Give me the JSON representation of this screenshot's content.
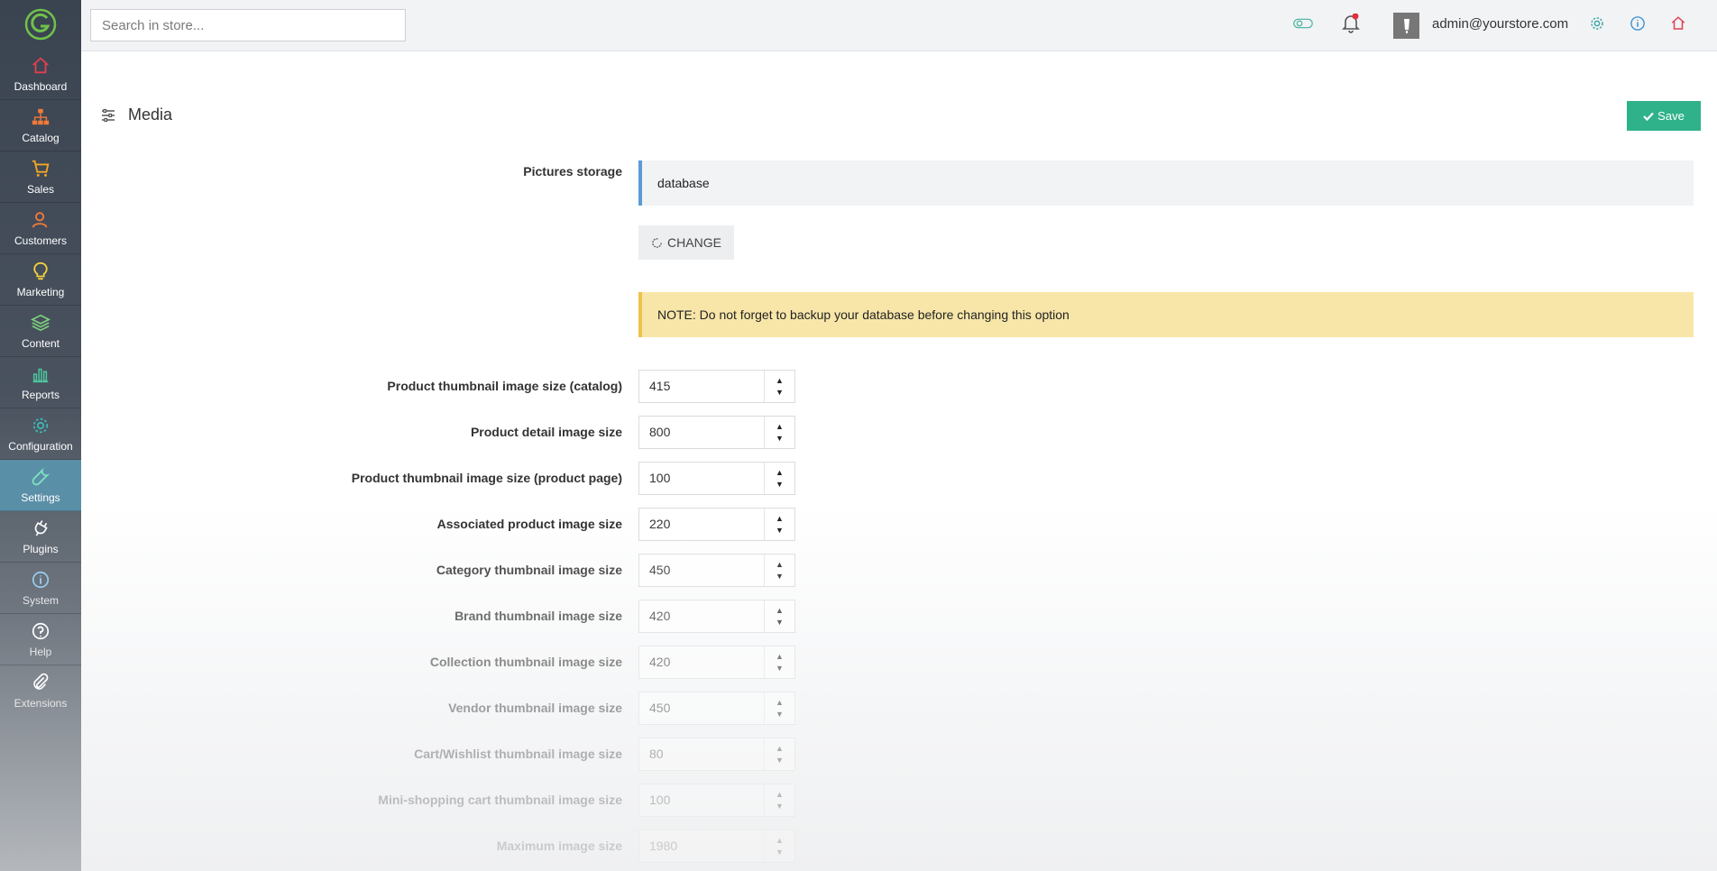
{
  "topbar": {
    "search_placeholder": "Search in store...",
    "user_email": "admin@yourstore.com"
  },
  "sidebar": {
    "items": [
      {
        "label": "Dashboard",
        "icon": "home-icon",
        "color": "#e0404f"
      },
      {
        "label": "Catalog",
        "icon": "sitemap-icon",
        "color": "#f07a3a"
      },
      {
        "label": "Sales",
        "icon": "cart-icon",
        "color": "#f5a623"
      },
      {
        "label": "Customers",
        "icon": "users-icon",
        "color": "#f07a3a"
      },
      {
        "label": "Marketing",
        "icon": "lightbulb-icon",
        "color": "#f5d33a"
      },
      {
        "label": "Content",
        "icon": "layers-icon",
        "color": "#7ed07e"
      },
      {
        "label": "Reports",
        "icon": "bar-chart-icon",
        "color": "#4ec9a0"
      },
      {
        "label": "Configuration",
        "icon": "gear-icon",
        "color": "#3fb6b6"
      },
      {
        "label": "Settings",
        "icon": "wrench-icon",
        "color": "#7ee0c0"
      },
      {
        "label": "Plugins",
        "icon": "plug-icon",
        "color": "#ffffff"
      },
      {
        "label": "System",
        "icon": "info-icon",
        "color": "#9ad0f0"
      },
      {
        "label": "Help",
        "icon": "question-icon",
        "color": "#ffffff"
      },
      {
        "label": "Extensions",
        "icon": "paperclip-icon",
        "color": "#ffffff"
      }
    ],
    "active": "Settings"
  },
  "page": {
    "title": "Media",
    "save_label": "Save",
    "storage_label": "Pictures storage",
    "storage_value": "database",
    "change_label": "CHANGE",
    "note": "NOTE: Do not forget to backup your database before changing this option"
  },
  "fields": [
    {
      "label": "Product thumbnail image size (catalog)",
      "value": "415"
    },
    {
      "label": "Product detail image size",
      "value": "800"
    },
    {
      "label": "Product thumbnail image size (product page)",
      "value": "100"
    },
    {
      "label": "Associated product image size",
      "value": "220"
    },
    {
      "label": "Category thumbnail image size",
      "value": "450"
    },
    {
      "label": "Brand thumbnail image size",
      "value": "420"
    },
    {
      "label": "Collection thumbnail image size",
      "value": "420"
    },
    {
      "label": "Vendor thumbnail image size",
      "value": "450"
    },
    {
      "label": "Cart/Wishlist thumbnail image size",
      "value": "80"
    },
    {
      "label": "Mini-shopping cart thumbnail image size",
      "value": "100"
    },
    {
      "label": "Maximum image size",
      "value": "1980"
    }
  ],
  "colors": {
    "accent": "#2fb28a",
    "sidebar_active": "#5a8fa8",
    "note_bg": "#f7e6a8",
    "notification_dot": "#e0303f"
  }
}
